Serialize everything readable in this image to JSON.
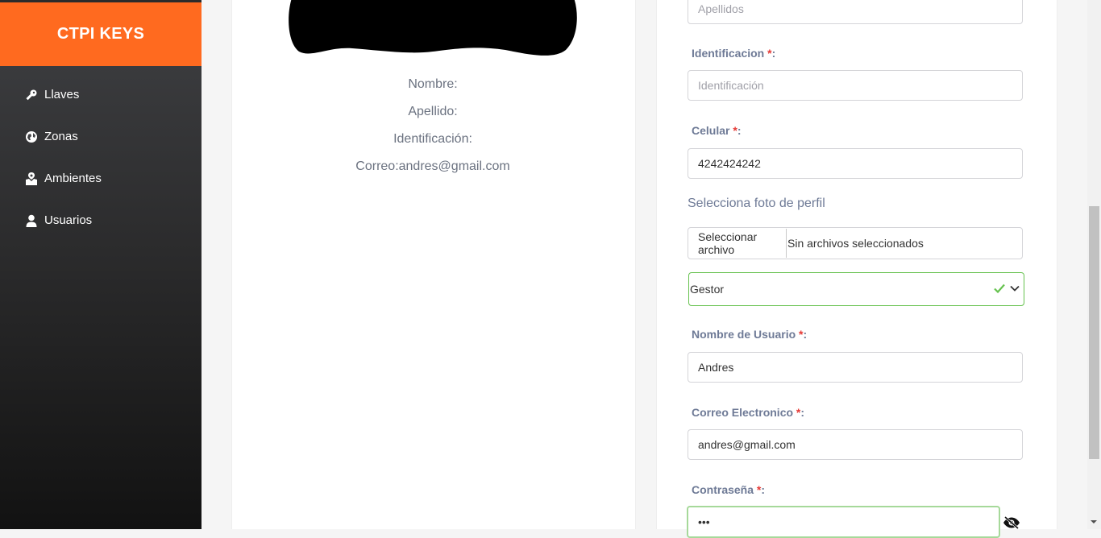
{
  "sidebar": {
    "brand": "CTPI KEYS",
    "items": [
      {
        "label": "Llaves",
        "icon": "key-icon"
      },
      {
        "label": "Zonas",
        "icon": "globe-icon"
      },
      {
        "label": "Ambientes",
        "icon": "map-location-icon"
      },
      {
        "label": "Usuarios",
        "icon": "user-icon"
      }
    ]
  },
  "profile": {
    "nombre": "Nombre:",
    "apellido": "Apellido:",
    "identificacion": "Identificación:",
    "correo": "Correo:andres@gmail.com"
  },
  "form": {
    "apellidos_placeholder": "Apellidos",
    "identificacion_label": "Identificacion",
    "identificacion_placeholder": "Identificación",
    "celular_label": "Celular",
    "celular_value": "4242424242",
    "foto_label": "Selecciona foto de perfil",
    "file_button": "Seleccionar archivo",
    "file_status": "Sin archivos seleccionados",
    "rol_value": "Gestor",
    "usuario_label": "Nombre de Usuario",
    "usuario_value": "Andres",
    "correo_label": "Correo Electronico",
    "correo_value": "andres@gmail.com",
    "password_label": "Contraseña",
    "password_value": "•••",
    "required_mark": "*",
    "colon": ":"
  },
  "colors": {
    "brand": "#ff6a1f",
    "required": "#e53935",
    "valid": "#66c24f"
  }
}
